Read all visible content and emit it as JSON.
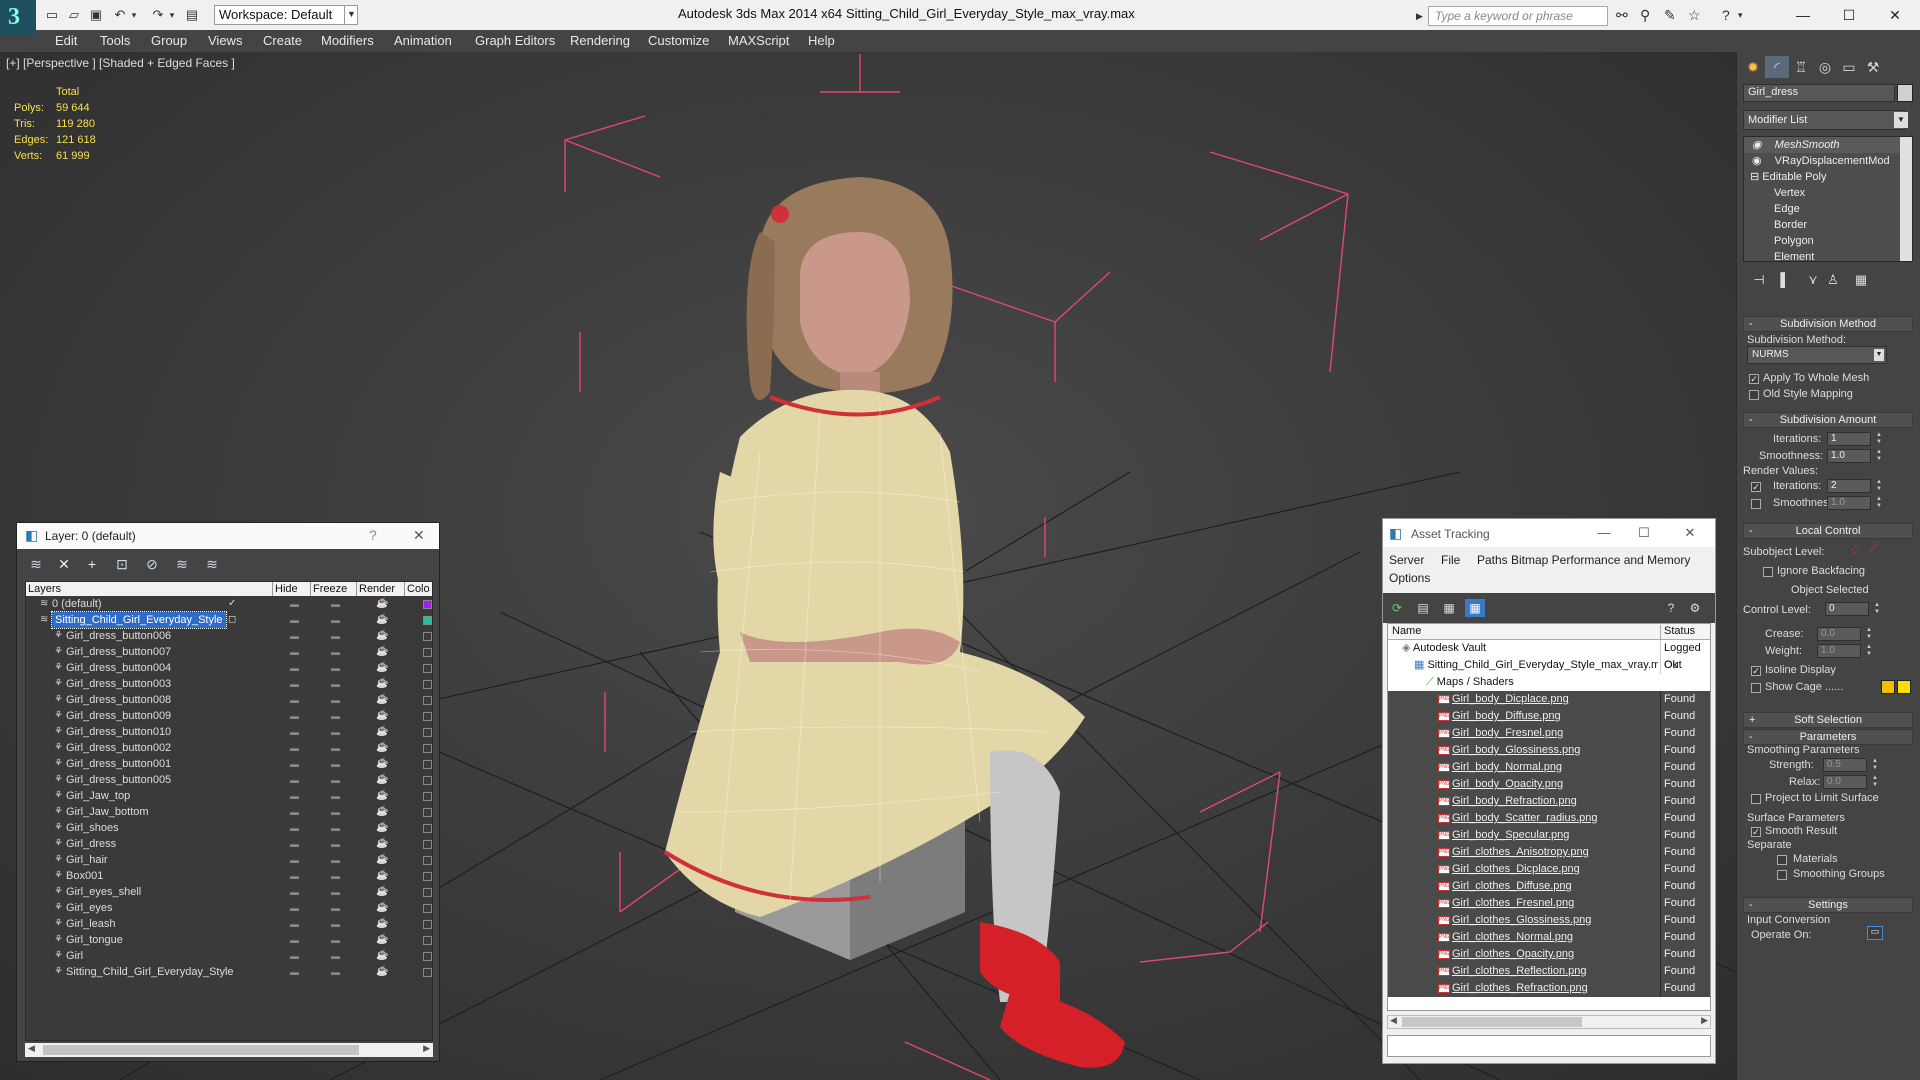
{
  "titlebar": {
    "workspace_label": "Workspace: Default",
    "app_title": "Autodesk 3ds Max  2014 x64",
    "file_title": "Sitting_Child_Girl_Everyday_Style_max_vray.max",
    "search_placeholder": "Type a keyword or phrase"
  },
  "menu": [
    "Edit",
    "Tools",
    "Group",
    "Views",
    "Create",
    "Modifiers",
    "Animation",
    "Graph Editors",
    "Rendering",
    "Customize",
    "MAXScript",
    "Help"
  ],
  "viewport": {
    "label": "[+] [Perspective ] [Shaded + Edged Faces ]",
    "stats": {
      "header": "Total",
      "rows": [
        {
          "label": "Polys:",
          "value": "59 644"
        },
        {
          "label": "Tris:",
          "value": "119 280"
        },
        {
          "label": "Edges:",
          "value": "121 618"
        },
        {
          "label": "Verts:",
          "value": "61 999"
        }
      ]
    }
  },
  "command_panel": {
    "object_name": "Girl_dress",
    "modifier_list": "Modifier List",
    "stack": [
      "MeshSmooth",
      "VRayDisplacementMod",
      "Editable Poly",
      "Vertex",
      "Edge",
      "Border",
      "Polygon",
      "Element"
    ],
    "subdivision_method": {
      "header": "Subdivision Method",
      "label": "Subdivision Method:",
      "value": "NURMS",
      "apply_whole_mesh": "Apply To Whole Mesh",
      "old_style": "Old Style Mapping"
    },
    "subdivision_amount": {
      "header": "Subdivision Amount",
      "iterations_label": "Iterations:",
      "iterations_value": "1",
      "smoothness_label": "Smoothness:",
      "smoothness_value": "1.0",
      "render_values": "Render Values:",
      "render_iterations_label": "Iterations:",
      "render_iterations_value": "2",
      "render_smoothness_label": "Smoothness:",
      "render_smoothness_value": "1.0"
    },
    "local_control": {
      "header": "Local Control",
      "subobject_level": "Subobject Level:",
      "ignore_backfacing": "Ignore Backfacing",
      "object_selected": "Object Selected",
      "control_level_label": "Control Level:",
      "control_level_value": "0",
      "crease_label": "Crease:",
      "crease_value": "0.0",
      "weight_label": "Weight:",
      "weight_value": "1.0",
      "isoline_display": "Isoline Display",
      "show_cage": "Show Cage ......"
    },
    "soft_selection": "Soft Selection",
    "parameters": {
      "header": "Parameters",
      "smoothing_parameters": "Smoothing Parameters",
      "strength_label": "Strength:",
      "strength_value": "0.5",
      "relax_label": "Relax:",
      "relax_value": "0.0",
      "project_limit": "Project to Limit Surface",
      "surface_parameters": "Surface Parameters",
      "smooth_result": "Smooth Result",
      "separate": "Separate",
      "materials": "Materials",
      "smoothing_groups": "Smoothing Groups"
    },
    "settings": {
      "header": "Settings",
      "input_conversion": "Input Conversion",
      "operate_on": "Operate On:"
    },
    "colors": {
      "cage_1": "#f0c000",
      "cage_2": "#ffe000"
    }
  },
  "layer_window": {
    "title": "Layer: 0 (default)",
    "columns": [
      "Layers",
      "Hide",
      "Freeze",
      "Render",
      "Colo"
    ],
    "rows": [
      {
        "name": "0 (default)",
        "level": 1,
        "color": "#a020f0",
        "type": "layer"
      },
      {
        "name": "Sitting_Child_Girl_Everyday_Style",
        "level": 1,
        "color": "#20c0a0",
        "type": "layer",
        "selected": true
      },
      {
        "name": "Girl_dress_button006",
        "level": 2,
        "type": "object"
      },
      {
        "name": "Girl_dress_button007",
        "level": 2,
        "type": "object"
      },
      {
        "name": "Girl_dress_button004",
        "level": 2,
        "type": "object"
      },
      {
        "name": "Girl_dress_button003",
        "level": 2,
        "type": "object"
      },
      {
        "name": "Girl_dress_button008",
        "level": 2,
        "type": "object"
      },
      {
        "name": "Girl_dress_button009",
        "level": 2,
        "type": "object"
      },
      {
        "name": "Girl_dress_button010",
        "level": 2,
        "type": "object"
      },
      {
        "name": "Girl_dress_button002",
        "level": 2,
        "type": "object"
      },
      {
        "name": "Girl_dress_button001",
        "level": 2,
        "type": "object"
      },
      {
        "name": "Girl_dress_button005",
        "level": 2,
        "type": "object"
      },
      {
        "name": "Girl_Jaw_top",
        "level": 2,
        "type": "object"
      },
      {
        "name": "Girl_Jaw_bottom",
        "level": 2,
        "type": "object"
      },
      {
        "name": "Girl_shoes",
        "level": 2,
        "type": "object"
      },
      {
        "name": "Girl_dress",
        "level": 2,
        "type": "object"
      },
      {
        "name": "Girl_hair",
        "level": 2,
        "type": "object"
      },
      {
        "name": "Box001",
        "level": 2,
        "type": "object"
      },
      {
        "name": "Girl_eyes_shell",
        "level": 2,
        "type": "object"
      },
      {
        "name": "Girl_eyes",
        "level": 2,
        "type": "object"
      },
      {
        "name": "Girl_leash",
        "level": 2,
        "type": "object"
      },
      {
        "name": "Girl_tongue",
        "level": 2,
        "type": "object"
      },
      {
        "name": "Girl",
        "level": 2,
        "type": "object"
      },
      {
        "name": "Sitting_Child_Girl_Everyday_Style",
        "level": 2,
        "type": "object"
      }
    ]
  },
  "asset_window": {
    "title": "Asset Tracking",
    "menus": [
      "Server",
      "File",
      "Paths",
      "Bitmap Performance and Memory",
      "Options"
    ],
    "columns": [
      "Name",
      "Status"
    ],
    "rows": [
      {
        "name": "Autodesk Vault",
        "status": "Logged Out",
        "level": 0,
        "type": "vault"
      },
      {
        "name": "Sitting_Child_Girl_Everyday_Style_max_vray.max",
        "status": "Ok",
        "level": 1,
        "type": "max"
      },
      {
        "name": "Maps / Shaders",
        "status": "",
        "level": 2,
        "type": "folder"
      },
      {
        "name": "Girl_body_Dicplace.png",
        "status": "Found",
        "level": 3,
        "type": "png"
      },
      {
        "name": "Girl_body_Diffuse.png",
        "status": "Found",
        "level": 3,
        "type": "png"
      },
      {
        "name": "Girl_body_Fresnel.png",
        "status": "Found",
        "level": 3,
        "type": "png"
      },
      {
        "name": "Girl_body_Glossiness.png",
        "status": "Found",
        "level": 3,
        "type": "png"
      },
      {
        "name": "Girl_body_Normal.png",
        "status": "Found",
        "level": 3,
        "type": "png"
      },
      {
        "name": "Girl_body_Opacity.png",
        "status": "Found",
        "level": 3,
        "type": "png"
      },
      {
        "name": "Girl_body_Refraction.png",
        "status": "Found",
        "level": 3,
        "type": "png"
      },
      {
        "name": "Girl_body_Scatter_radius.png",
        "status": "Found",
        "level": 3,
        "type": "png"
      },
      {
        "name": "Girl_body_Specular.png",
        "status": "Found",
        "level": 3,
        "type": "png"
      },
      {
        "name": "Girl_clothes_Anisotropy.png",
        "status": "Found",
        "level": 3,
        "type": "png"
      },
      {
        "name": "Girl_clothes_Dicplace.png",
        "status": "Found",
        "level": 3,
        "type": "png"
      },
      {
        "name": "Girl_clothes_Diffuse.png",
        "status": "Found",
        "level": 3,
        "type": "png"
      },
      {
        "name": "Girl_clothes_Fresnel.png",
        "status": "Found",
        "level": 3,
        "type": "png"
      },
      {
        "name": "Girl_clothes_Glossiness.png",
        "status": "Found",
        "level": 3,
        "type": "png"
      },
      {
        "name": "Girl_clothes_Normal.png",
        "status": "Found",
        "level": 3,
        "type": "png"
      },
      {
        "name": "Girl_clothes_Opacity.png",
        "status": "Found",
        "level": 3,
        "type": "png"
      },
      {
        "name": "Girl_clothes_Reflection.png",
        "status": "Found",
        "level": 3,
        "type": "png"
      },
      {
        "name": "Girl_clothes_Refraction.png",
        "status": "Found",
        "level": 3,
        "type": "png"
      }
    ]
  }
}
